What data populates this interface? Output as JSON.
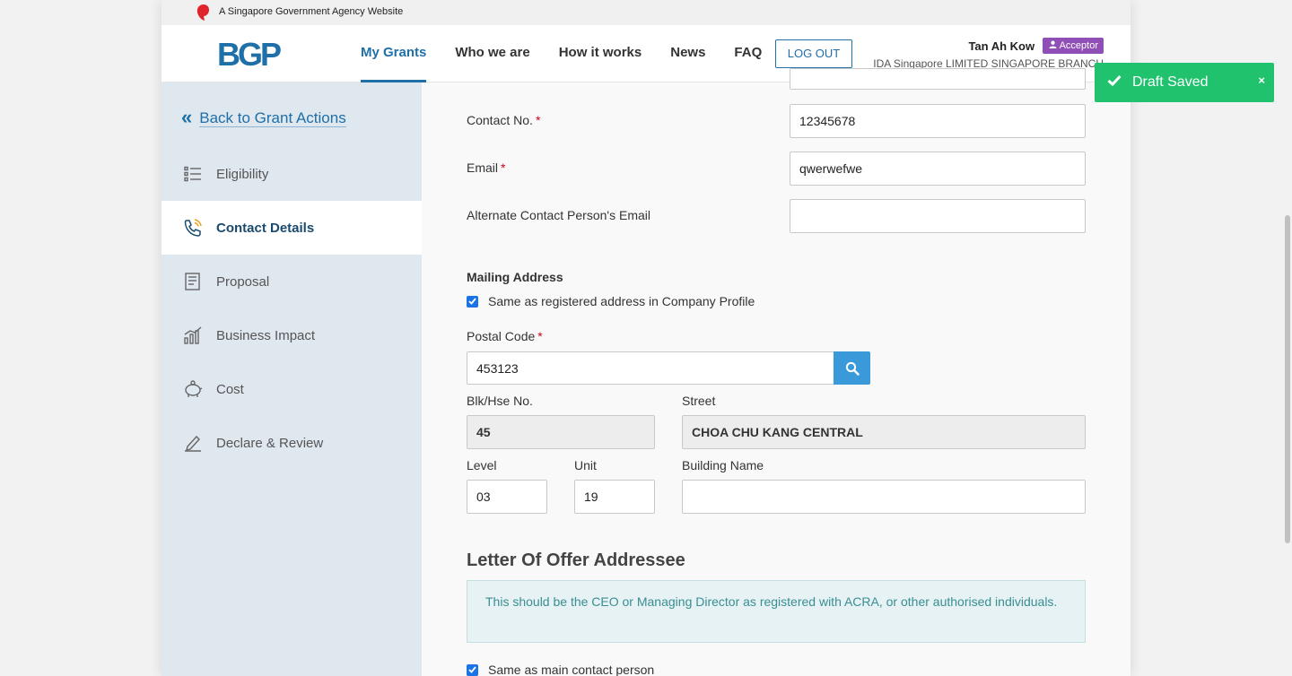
{
  "masthead": {
    "text": "A Singapore Government Agency Website"
  },
  "header": {
    "logo": "BGP",
    "nav": [
      "My Grants",
      "Who we are",
      "How it works",
      "News",
      "FAQ"
    ],
    "logout": "LOG OUT",
    "user_name": "Tan Ah Kow",
    "role_badge": "Acceptor",
    "org": "IDA Singapore LIMITED SINGAPORE BRANCH"
  },
  "sidebar": {
    "back_label": "Back to Grant Actions",
    "items": [
      {
        "label": "Eligibility",
        "icon": "list-icon"
      },
      {
        "label": "Contact Details",
        "icon": "phone-icon"
      },
      {
        "label": "Proposal",
        "icon": "document-icon"
      },
      {
        "label": "Business Impact",
        "icon": "chart-icon"
      },
      {
        "label": "Cost",
        "icon": "piggybank-icon"
      },
      {
        "label": "Declare & Review",
        "icon": "signature-icon"
      }
    ]
  },
  "form": {
    "contact_no_label": "Contact No.",
    "contact_no_value": "12345678",
    "email_label": "Email",
    "email_value": "qwerwefwe",
    "alt_email_label": "Alternate Contact Person's Email",
    "alt_email_value": "",
    "mailing_title": "Mailing Address",
    "same_as_registered": "Same as registered address in Company Profile",
    "postal_label": "Postal Code",
    "postal_value": "453123",
    "blk_label": "Blk/Hse No.",
    "blk_value": "45",
    "street_label": "Street",
    "street_value": "CHOA CHU KANG CENTRAL",
    "level_label": "Level",
    "level_value": "03",
    "unit_label": "Unit",
    "unit_value": "19",
    "building_label": "Building Name",
    "building_value": "",
    "required_mark": "*",
    "loo_title": "Letter Of Offer Addressee",
    "loo_info": "This should be the CEO or Managing Director as registered with ACRA, or other authorised individuals.",
    "same_as_main": "Same as main contact person"
  },
  "toast": {
    "text": "Draft Saved",
    "close": "×"
  },
  "colors": {
    "primary": "#1f6fa8",
    "success": "#21c26e",
    "badge": "#8f4fb6",
    "required": "#d0021b"
  }
}
